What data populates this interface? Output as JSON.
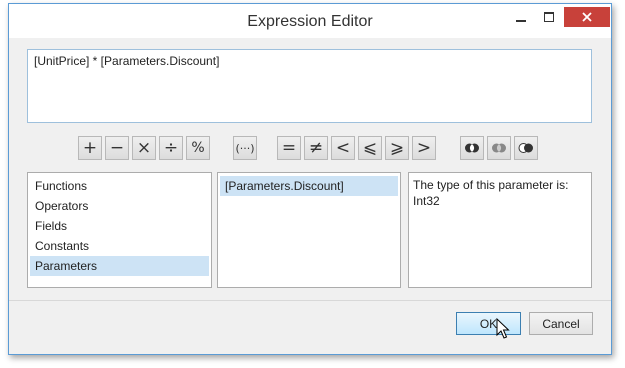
{
  "window": {
    "title": "Expression Editor"
  },
  "expression": {
    "value": "[UnitPrice] * [Parameters.Discount]"
  },
  "operators": {
    "plus": "+",
    "minus": "−",
    "multiply": "×",
    "divide": "÷",
    "percent": "%",
    "parentheses": "(···)",
    "equal": "=",
    "not_equal": "≠",
    "less": "<",
    "less_equal": "⩽",
    "greater_equal": "⩾",
    "greater": ">"
  },
  "categories": [
    "Functions",
    "Operators",
    "Fields",
    "Constants",
    "Parameters"
  ],
  "selected_category": "Parameters",
  "items": [
    "[Parameters.Discount]"
  ],
  "description": "The type of this parameter is: Int32",
  "buttons": {
    "ok": "OK",
    "cancel": "Cancel"
  },
  "colors": {
    "accent_border": "#5b9bd5",
    "selection": "#cde3f5",
    "close_button": "#c8413a"
  }
}
